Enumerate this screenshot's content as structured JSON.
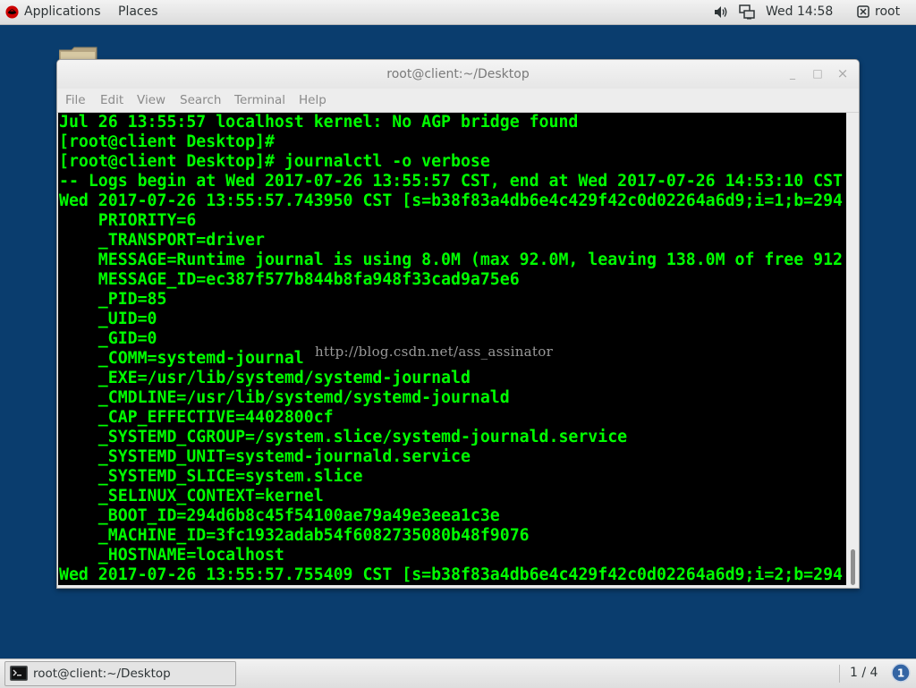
{
  "topbar": {
    "applications": "Applications",
    "places": "Places",
    "clock": "Wed 14:58",
    "user": "root",
    "icons": [
      "redhat-logo-icon",
      "volume-icon",
      "network-icon",
      "user-icon"
    ]
  },
  "window": {
    "title": "root@client:~/Desktop",
    "minimize": "_",
    "maximize": "□",
    "close": "×"
  },
  "menu": [
    "File",
    "Edit",
    "View",
    "Search",
    "Terminal",
    "Help"
  ],
  "terminal": {
    "text_color": "#00ff00",
    "background": "#000000",
    "lines": [
      "Jul 26 13:55:57 localhost kernel: No AGP bridge found",
      "[root@client Desktop]#",
      "[root@client Desktop]# journalctl -o verbose",
      "-- Logs begin at Wed 2017-07-26 13:55:57 CST, end at Wed 2017-07-26 14:53:10 CST",
      "Wed 2017-07-26 13:55:57.743950 CST [s=b38f83a4db6e4c429f42c0d02264a6d9;i=1;b=294",
      "    PRIORITY=6",
      "    _TRANSPORT=driver",
      "    MESSAGE=Runtime journal is using 8.0M (max 92.0M, leaving 138.0M of free 912",
      "    MESSAGE_ID=ec387f577b844b8fa948f33cad9a75e6",
      "    _PID=85",
      "    _UID=0",
      "    _GID=0",
      "    _COMM=systemd-journal",
      "    _EXE=/usr/lib/systemd/systemd-journald",
      "    _CMDLINE=/usr/lib/systemd/systemd-journald",
      "    _CAP_EFFECTIVE=4402800cf",
      "    _SYSTEMD_CGROUP=/system.slice/systemd-journald.service",
      "    _SYSTEMD_UNIT=systemd-journald.service",
      "    _SYSTEMD_SLICE=system.slice",
      "    _SELINUX_CONTEXT=kernel",
      "    _BOOT_ID=294d6b8c45f54100ae79a49e3eea1c3e",
      "    _MACHINE_ID=3fc1932adab54f6082735080b48f9076",
      "    _HOSTNAME=localhost",
      "Wed 2017-07-26 13:55:57.755409 CST [s=b38f83a4db6e4c429f42c0d02264a6d9;i=2;b=294"
    ]
  },
  "watermark": "http://blog.csdn.net/ass_assinator",
  "taskbar": {
    "task_label": "root@client:~/Desktop",
    "workspace": "1 / 4",
    "notification_count": "1"
  }
}
